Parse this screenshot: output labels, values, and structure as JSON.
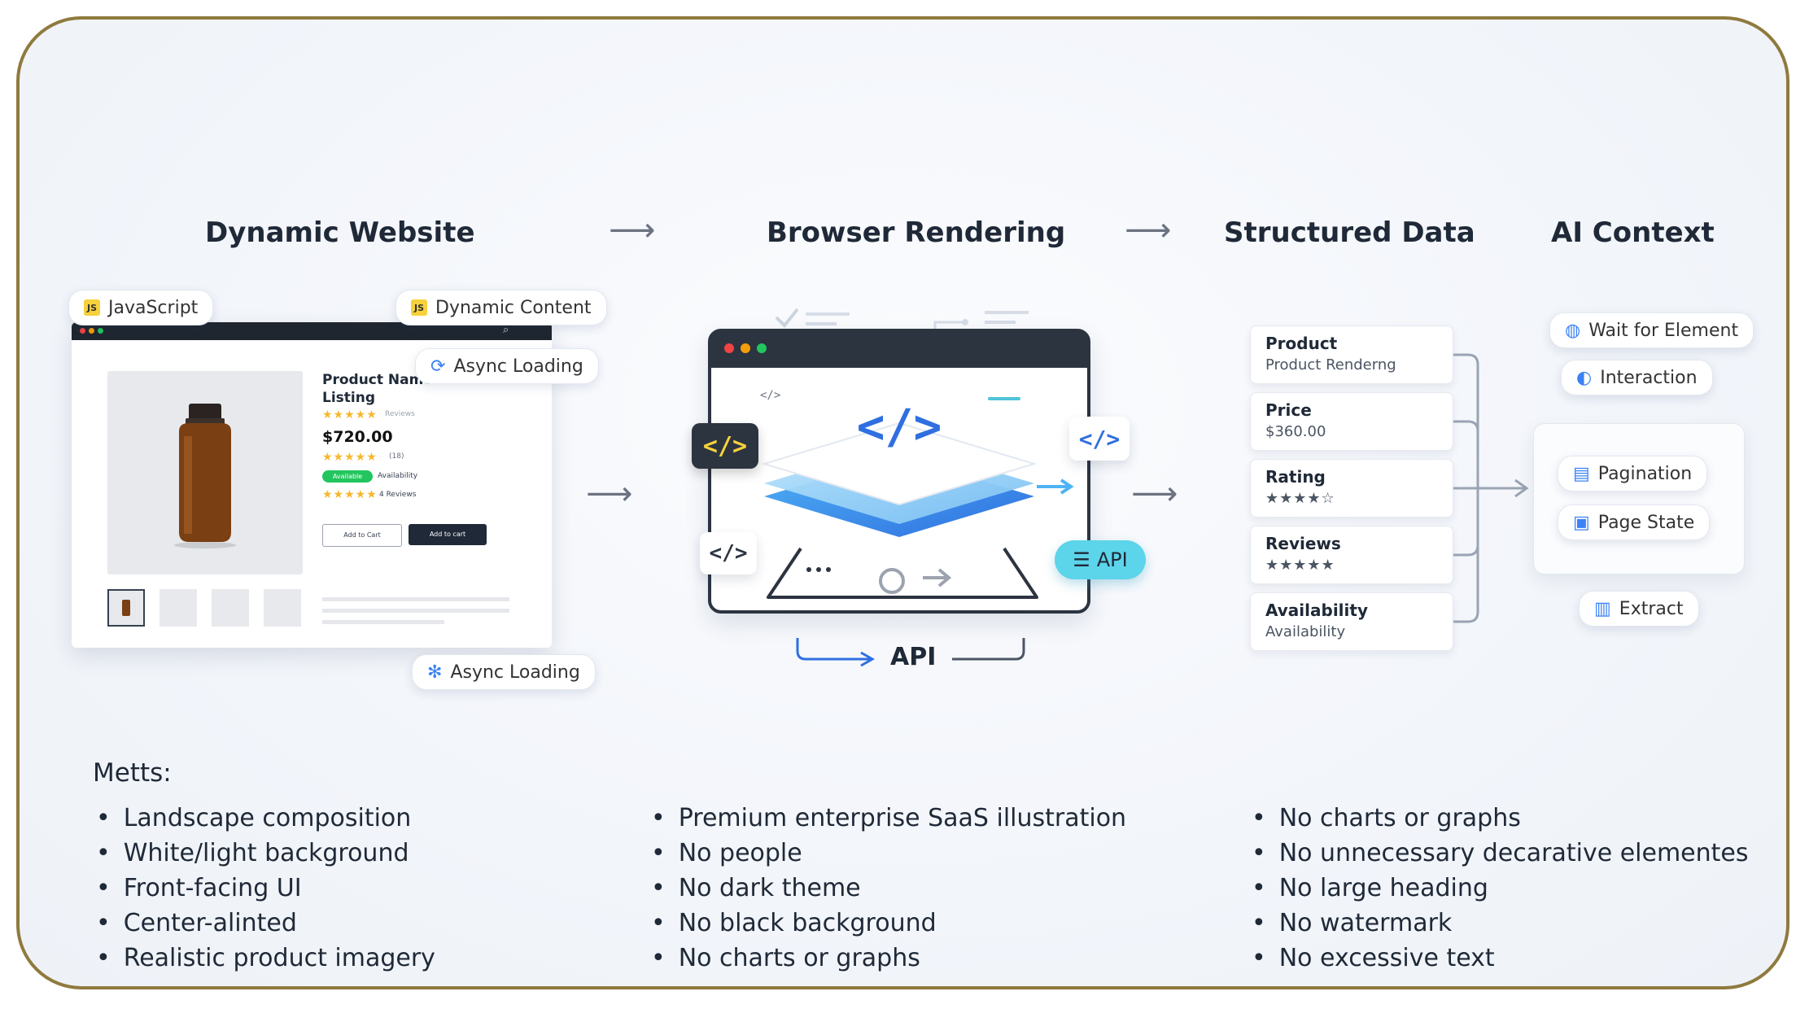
{
  "stages": {
    "dynamic_website": "Dynamic Website",
    "browser_rendering": "Browser Rendering",
    "structured_data": "Structured Data",
    "ai_context": "AI Context"
  },
  "website": {
    "chip_javascript": "JavaScript",
    "chip_dynamic_content": "Dynamic Content",
    "chip_async_loading_top": "Async Loading",
    "chip_async_loading_bottom": "Async Loading",
    "product_title": "Product Name Product Listing",
    "price": "$720.00",
    "reviews_small": "Reviews",
    "rating_count": "(18)",
    "availability_badge": "Available",
    "availability_text": "Availability",
    "reviews_count": "4 Reviews",
    "add_to_cart": "Add to Cart",
    "add_cart_dark": "Add to cart"
  },
  "browser": {
    "code_tag": "</>",
    "code_small": "</>",
    "api_badge": "API",
    "api_label": "API"
  },
  "fields": [
    {
      "label": "Product",
      "value": "Product Renderng"
    },
    {
      "label": "Price",
      "value": "$360.00"
    },
    {
      "label": "Rating",
      "value": "★★★★☆"
    },
    {
      "label": "Reviews",
      "value": "★★★★★"
    },
    {
      "label": "Availability",
      "value": "Availability"
    }
  ],
  "ai_context": {
    "wait_for_element": "Wait for Element",
    "interaction": "Interaction",
    "pagination": "Pagination",
    "page_state": "Page State",
    "extract": "Extract"
  },
  "notes": {
    "title": "Metts:",
    "col1": [
      "Landscape composition",
      "White/light background",
      "Front-facing UI",
      "Center-alinted",
      "Realistic product imagery"
    ],
    "col2": [
      "Premium enterprise SaaS illustration",
      "No people",
      "No dark theme",
      "No black background",
      "No charts or graphs"
    ],
    "col3": [
      "No charts or graphs",
      "No unnecessary decarative elementes",
      "No large heading",
      "No watermark",
      "No excessive text"
    ]
  },
  "colors": {
    "frame_border": "#8f7a3e",
    "accent_blue": "#3b82f6",
    "star_gold": "#f5b82e",
    "badge_green": "#22c55e",
    "api_cyan": "#5cd4ea"
  }
}
